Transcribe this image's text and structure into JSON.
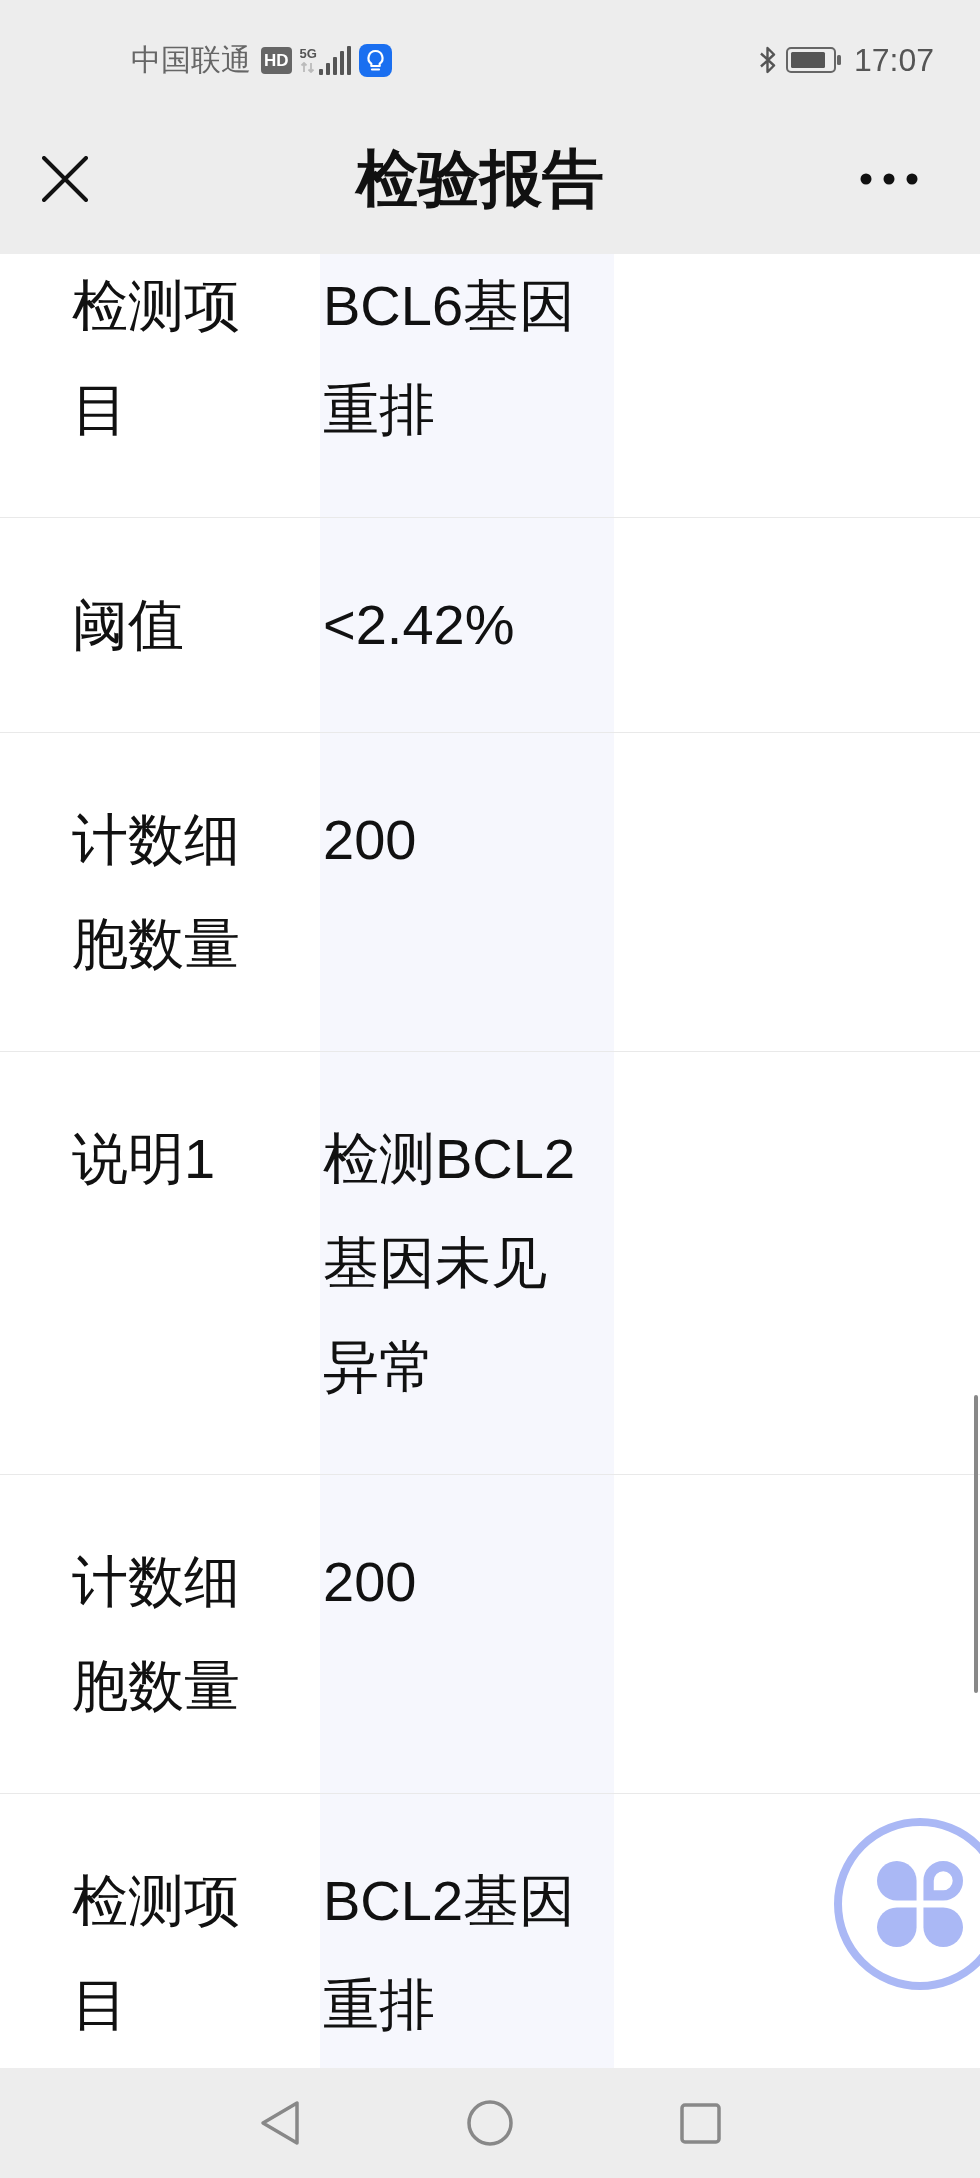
{
  "status_bar": {
    "carrier": "中国联通",
    "hd": "HD",
    "network": "5G",
    "time": "17:07"
  },
  "header": {
    "title": "检验报告"
  },
  "rows": [
    {
      "label": "检测项目",
      "value": "BCL6基因重排"
    },
    {
      "label": "阈值",
      "value": "<2.42%"
    },
    {
      "label": "计数细胞数量",
      "value": "200"
    },
    {
      "label": "说明1",
      "value": "检测BCL2基因未见异常"
    },
    {
      "label": "计数细胞数量",
      "value": "200"
    },
    {
      "label": "检测项目",
      "value": "BCL2基因重排"
    }
  ]
}
